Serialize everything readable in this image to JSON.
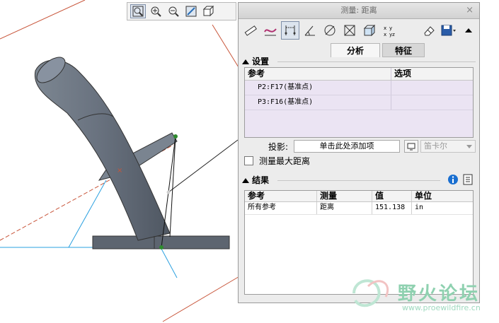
{
  "dialog": {
    "title": "测量: 距离",
    "close_glyph": "×",
    "tabs": [
      {
        "label": "分析"
      },
      {
        "label": "特征"
      }
    ]
  },
  "view_toolbar": {
    "icons": [
      "zoom-window-icon",
      "zoom-in-icon",
      "zoom-out-icon",
      "refit-icon",
      "view-orientation-icon"
    ]
  },
  "measure_toolbar": {
    "icons": [
      "ruler-icon",
      "curve-length-icon",
      "distance-icon",
      "angle-icon",
      "diameter-icon",
      "area-icon",
      "volume-icon",
      "transform-icon",
      "eraser-icon",
      "save-icon",
      "collapse-icon"
    ]
  },
  "settings": {
    "header": "设置",
    "columns": [
      "参考",
      "选项"
    ],
    "references": [
      {
        "ref": "P2:F17(基准点)",
        "option": ""
      },
      {
        "ref": "P3:F16(基准点)",
        "option": ""
      }
    ],
    "projection_label": "投影:",
    "projection_placeholder": "单击此处添加项",
    "coord_system": "笛卡尔",
    "max_distance_label": "测量最大距离"
  },
  "results": {
    "header": "结果",
    "columns": [
      "参考",
      "测量",
      "值",
      "单位"
    ],
    "rows": [
      {
        "ref": "所有参考",
        "measure": "距离",
        "value": "151.138",
        "unit": "in"
      }
    ]
  },
  "watermark": {
    "text": "野火论坛",
    "url": "www.proewildfire.cn"
  },
  "colors": {
    "pipe": "#6b7480",
    "accent_blue": "#1a6fd0",
    "reference_bg": "#ebe4f3",
    "watermark": "#8fd1b0"
  }
}
